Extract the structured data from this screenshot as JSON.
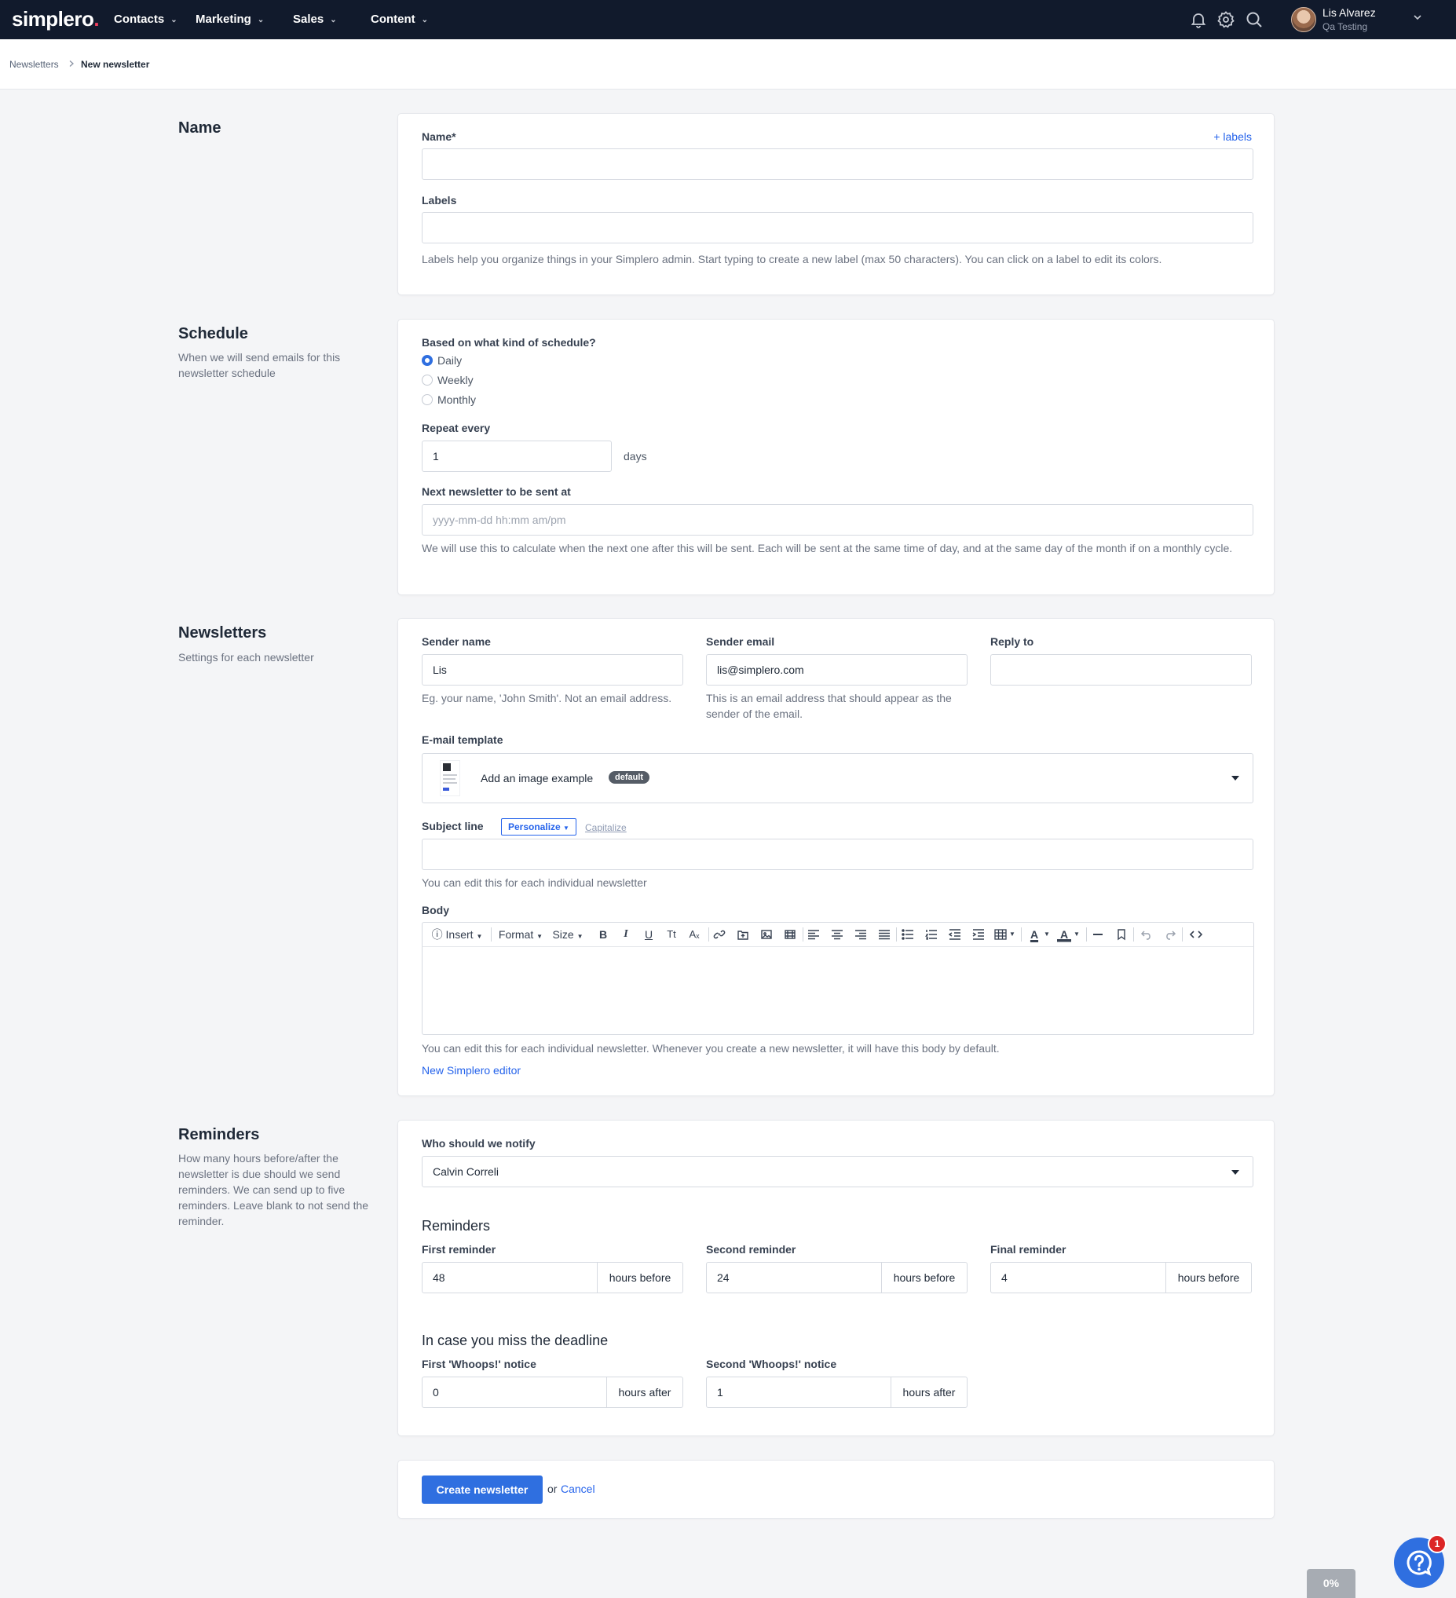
{
  "nav": {
    "brand": "simplero",
    "brand_dot": ".",
    "items": [
      {
        "label": "Contacts"
      },
      {
        "label": "Marketing"
      },
      {
        "label": "Sales"
      },
      {
        "label": "Content"
      }
    ],
    "user": {
      "name": "Lis Alvarez",
      "org": "Qa Testing"
    }
  },
  "breadcrumb": {
    "parent": "Newsletters",
    "current": "New newsletter"
  },
  "name_section": {
    "title": "Name",
    "name_label": "Name*",
    "add_labels_link": "+ labels",
    "name_value": "",
    "labels_label": "Labels",
    "labels_value": "",
    "labels_hint": "Labels help you organize things in your Simplero admin. Start typing to create a new label (max 50 characters). You can click on a label to edit its colors."
  },
  "schedule_section": {
    "title": "Schedule",
    "description": "When we will send emails for this newsletter schedule",
    "kind_label": "Based on what kind of schedule?",
    "options": [
      {
        "label": "Daily",
        "selected": true
      },
      {
        "label": "Weekly",
        "selected": false
      },
      {
        "label": "Monthly",
        "selected": false
      }
    ],
    "repeat_label": "Repeat every",
    "repeat_value": "1",
    "repeat_unit": "days",
    "next_label": "Next newsletter to be sent at",
    "next_placeholder": "yyyy-mm-dd hh:mm am/pm",
    "next_hint": "We will use this to calculate when the next one after this will be sent. Each will be sent at the same time of day, and at the same day of the month if on a monthly cycle."
  },
  "newsletters_section": {
    "title": "Newsletters",
    "description": "Settings for each newsletter",
    "sender_name_label": "Sender name",
    "sender_name_value": "Lis",
    "sender_name_hint": "Eg. your name, 'John Smith'. Not an email address.",
    "sender_email_label": "Sender email",
    "sender_email_value": "lis@simplero.com",
    "sender_email_hint": "This is an email address that should appear as the sender of the email.",
    "reply_to_label": "Reply to",
    "reply_to_value": "",
    "template_label": "E-mail template",
    "template_value": "Add an image example",
    "template_badge": "default",
    "subject_label": "Subject line",
    "personalize_label": "Personalize",
    "capitalize_label": "Capitalize",
    "subject_value": "",
    "subject_hint": "You can edit this for each individual newsletter",
    "body_label": "Body",
    "toolbar": {
      "insert": "Insert",
      "format": "Format",
      "size": "Size",
      "bold": "B",
      "italic": "I",
      "underline": "U",
      "text_transform": "Tt",
      "clear_format": "Aₓ"
    },
    "body_hint": "You can edit this for each individual newsletter. Whenever you create a new newsletter, it will have this body by default.",
    "editor_link": "New Simplero editor"
  },
  "reminders_section": {
    "title": "Reminders",
    "description": "How many hours before/after the newsletter is due should we send reminders. We can send up to five reminders. Leave blank to not send the reminder.",
    "notify_label": "Who should we notify",
    "notify_value": "Calvin Correli",
    "reminders_heading": "Reminders",
    "reminders": [
      {
        "label": "First reminder",
        "value": "48",
        "unit": "hours before"
      },
      {
        "label": "Second reminder",
        "value": "24",
        "unit": "hours before"
      },
      {
        "label": "Final reminder",
        "value": "4",
        "unit": "hours before"
      }
    ],
    "missed_heading": "In case you miss the deadline",
    "whoops": [
      {
        "label": "First 'Whoops!' notice",
        "value": "0",
        "unit": "hours after"
      },
      {
        "label": "Second 'Whoops!' notice",
        "value": "1",
        "unit": "hours after"
      }
    ]
  },
  "actions": {
    "submit": "Create newsletter",
    "or": "or",
    "cancel": "Cancel"
  },
  "widgets": {
    "help_count": "1",
    "progress": "0%"
  },
  "colors": {
    "nav_bg": "#111a2c",
    "accent": "#2f6fe0",
    "link": "#2563eb",
    "brand_dot": "#f43f5e",
    "badge_red": "#dc2626"
  }
}
